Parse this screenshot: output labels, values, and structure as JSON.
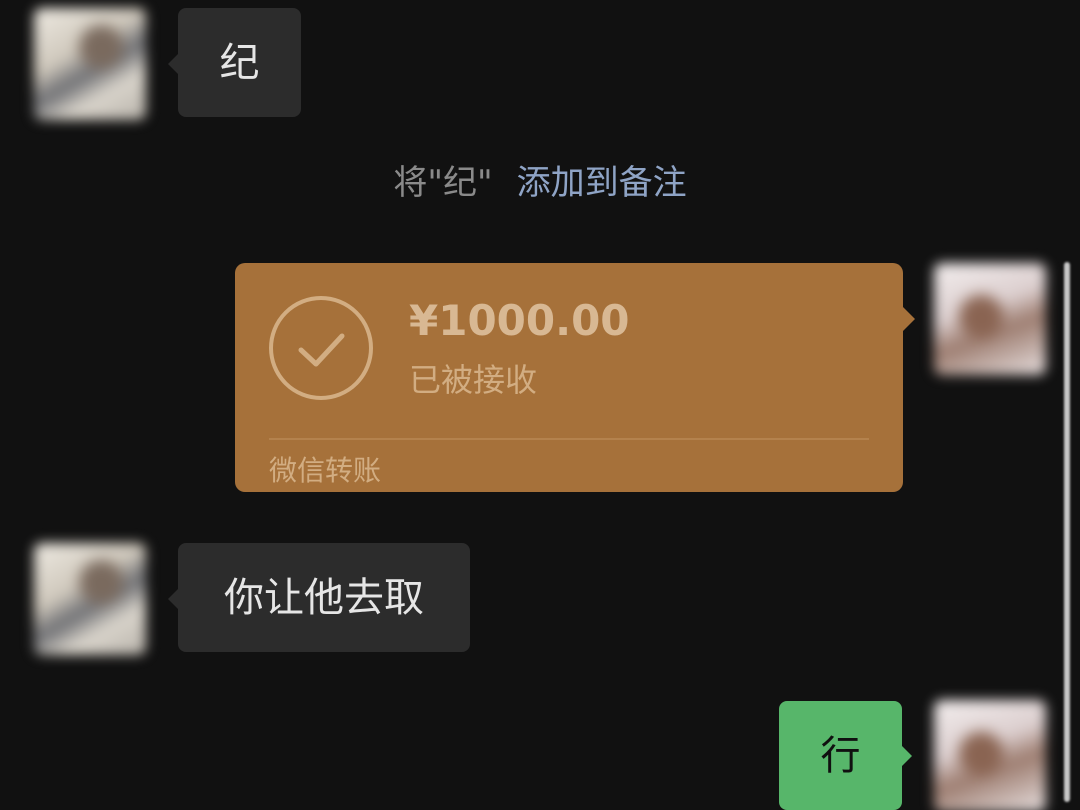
{
  "messages": {
    "first": {
      "side": "incoming",
      "text": "纪"
    },
    "second": {
      "side": "incoming",
      "text": "你让他去取"
    },
    "third": {
      "side": "outgoing",
      "text": "行"
    }
  },
  "notice": {
    "text": "将\"纪\"",
    "link": "添加到备注"
  },
  "transfer": {
    "amount": "¥1000.00",
    "status": "已被接收",
    "footer": "微信转账",
    "icon": "check-circle-icon"
  },
  "colors": {
    "background": "#111111",
    "incoming_bubble": "#2c2c2c",
    "outgoing_bubble": "#57b66a",
    "transfer_card": "#a6713a",
    "link": "#8fa4c6"
  }
}
